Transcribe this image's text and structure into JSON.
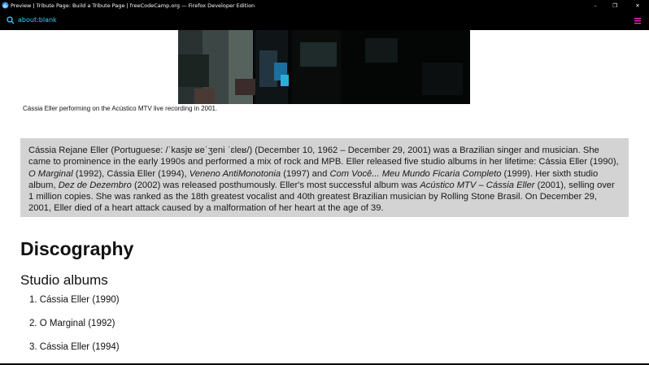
{
  "window": {
    "title": "Preview | Tribute Page: Build a Tribute Page | freeCodeCamp.org — Firefox Developer Edition",
    "controls": {
      "minimize": "–",
      "maximize": "❐",
      "close": "✕"
    }
  },
  "urlbar": {
    "url": "about:blank",
    "accent": "#2ad8ff",
    "menu_color": "#ff2bd6"
  },
  "figure": {
    "caption": "Cássia Eller performing on the Acústico MTV live recording in 2001."
  },
  "bio": {
    "t1": "Cássia Rejane Eller (Portuguese: /ˈkasjɐ ʁeˈʒeni ˈɛleʁ/) (December 10, 1962 – December 29, 2001) was a Brazilian singer and musician. She came to prominence in the early 1990s and performed a mix of rock and MPB. Eller released five studio albums in her lifetime: Cássia Eller (1990), ",
    "i1": "O Marginal",
    "t2": " (1992), Cássia Eller (1994), ",
    "i2": "Veneno AntiMonotonia",
    "t3": " (1997) and ",
    "i3": "Com Você... Meu Mundo Ficaria Completo",
    "t4": " (1999). Her sixth studio album, ",
    "i4": "Dez de Dezembro",
    "t5": " (2002) was released posthumously. Eller's most successful album was ",
    "i5": "Acústico MTV – Cássia Eller",
    "t6": " (2001), selling over 1 million copies. She was ranked as the 18th greatest vocalist and 40th greatest Brazilian musician by Rolling Stone Brasil. On December 29, 2001, Eller died of a heart attack caused by a malformation of her heart at the age of 39."
  },
  "discography": {
    "heading": "Discography",
    "subheading": "Studio albums",
    "albums": [
      "1. Cássia Eller (1990)",
      "2. O Marginal (1992)",
      "3. Cássia Eller (1994)"
    ]
  }
}
